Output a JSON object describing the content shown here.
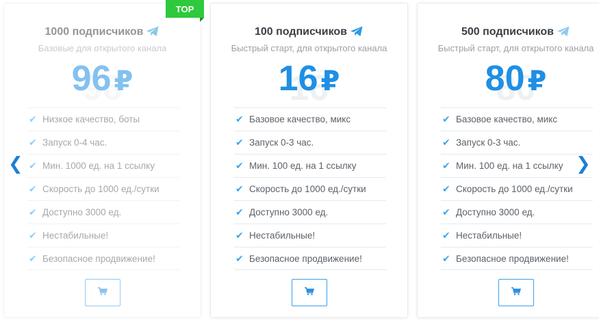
{
  "badge": "TOP",
  "nav": {
    "prev": "❮",
    "next": "❯"
  },
  "accent_color": "#1f8fe5",
  "badge_color": "#2ec93c",
  "cards": [
    {
      "title": "1000 подписчиков",
      "subtitle": "Базовые для открытого канала",
      "price": "96",
      "currency": "₽",
      "features": [
        "Низкое качество, боты",
        "Запуск 0-4 час.",
        "Мин. 1000 ед. на 1 ссылку",
        "Скорость до 1000 ед./сутки",
        "Доступно 3000 ед.",
        "Нестабильные!",
        "Безопасное продвижение!"
      ]
    },
    {
      "title": "100 подписчиков",
      "subtitle": "Быстрый старт, для открытого канала",
      "price": "16",
      "currency": "₽",
      "features": [
        "Базовое качество, микс",
        "Запуск 0-3 час.",
        "Мин. 100 ед. на 1 ссылку",
        "Скорость до 1000 ед./сутки",
        "Доступно 3000 ед.",
        "Нестабильные!",
        "Безопасное продвижение!"
      ]
    },
    {
      "title": "500 подписчиков",
      "subtitle": "Быстрый старт, для открытого канала",
      "price": "80",
      "currency": "₽",
      "features": [
        "Базовое качество, микс",
        "Запуск 0-3 час.",
        "Мин. 100 ед. на 1 ссылку",
        "Скорость до 1000 ед./сутки",
        "Доступно 3000 ед.",
        "Нестабильные!",
        "Безопасное продвижение!"
      ]
    }
  ]
}
